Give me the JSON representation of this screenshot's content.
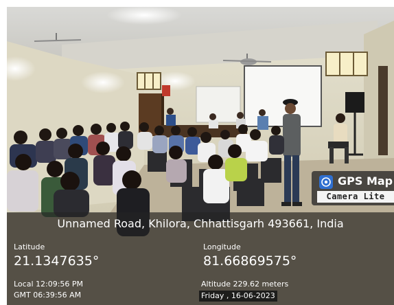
{
  "stamp": {
    "app_name": "GPS Map",
    "app_subtitle": "Camera Lite",
    "icon": "map-pin-globe-icon"
  },
  "location": {
    "address": "Unnamed Road, Khilora, Chhattisgarh 493661, India",
    "latitude_label": "Latitude",
    "latitude": "21.1347635°",
    "longitude_label": "Longitude",
    "longitude": "81.66869575°",
    "local_time": "Local 12:09:56 PM",
    "gmt_time": "GMT 06:39:56 AM",
    "altitude": "Altitude 229.62 meters",
    "date": "Friday , 16-06-2023"
  },
  "colors": {
    "overlay": "#232323",
    "text": "#ffffff",
    "badge_sub_bg": "#f4f4f4"
  }
}
